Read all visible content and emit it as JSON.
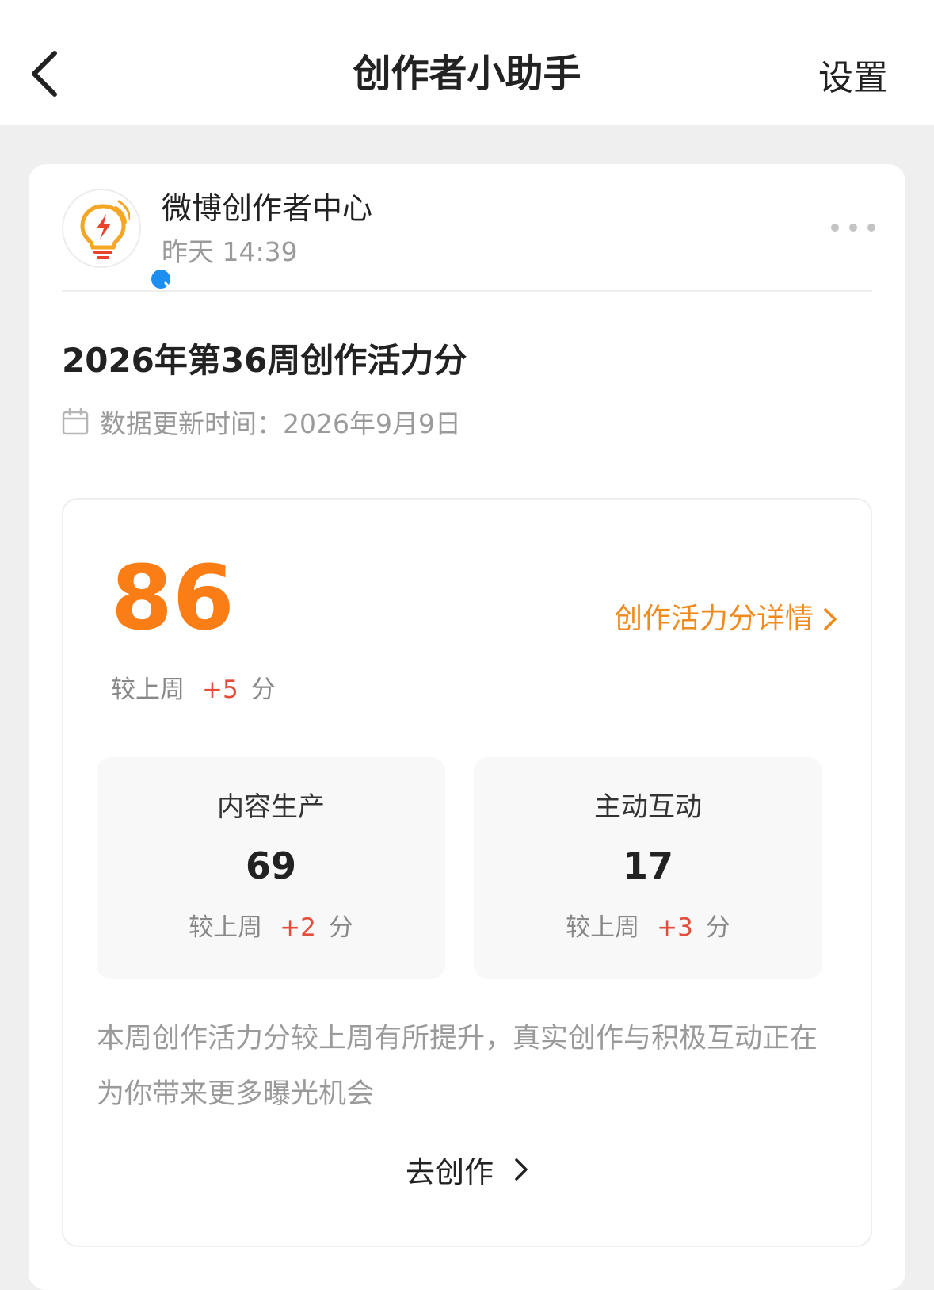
{
  "header": {
    "title": "创作者小助手",
    "settings_label": "设置"
  },
  "message": {
    "sender_name": "微博创作者中心",
    "time": "昨天 14:39",
    "title": "2026年第36周创作活力分",
    "update_label": "数据更新时间：",
    "update_date": "2026年9月9日"
  },
  "score": {
    "value": "86",
    "details_link": "创作活力分详情",
    "delta_prefix": "较上周",
    "delta_value": "+5",
    "delta_unit": "分"
  },
  "sub_scores": [
    {
      "label": "内容生产",
      "value": "69",
      "delta_prefix": "较上周",
      "delta_value": "+2",
      "delta_unit": "分"
    },
    {
      "label": "主动互动",
      "value": "17",
      "delta_prefix": "较上周",
      "delta_value": "+3",
      "delta_unit": "分"
    }
  ],
  "summary": "本周创作活力分较上周有所提升，真实创作与积极互动正在为你带来更多曝光机会",
  "cta_label": "去创作",
  "colors": {
    "accent_orange": "#fb7d15",
    "positive_delta_red": "#e24d3c",
    "verified_blue": "#1d8ff0"
  },
  "icons": [
    "back-chevron-icon",
    "bulb-logo-icon",
    "verified-icon",
    "more-dots-icon",
    "calendar-icon",
    "chevron-right-icon"
  ]
}
